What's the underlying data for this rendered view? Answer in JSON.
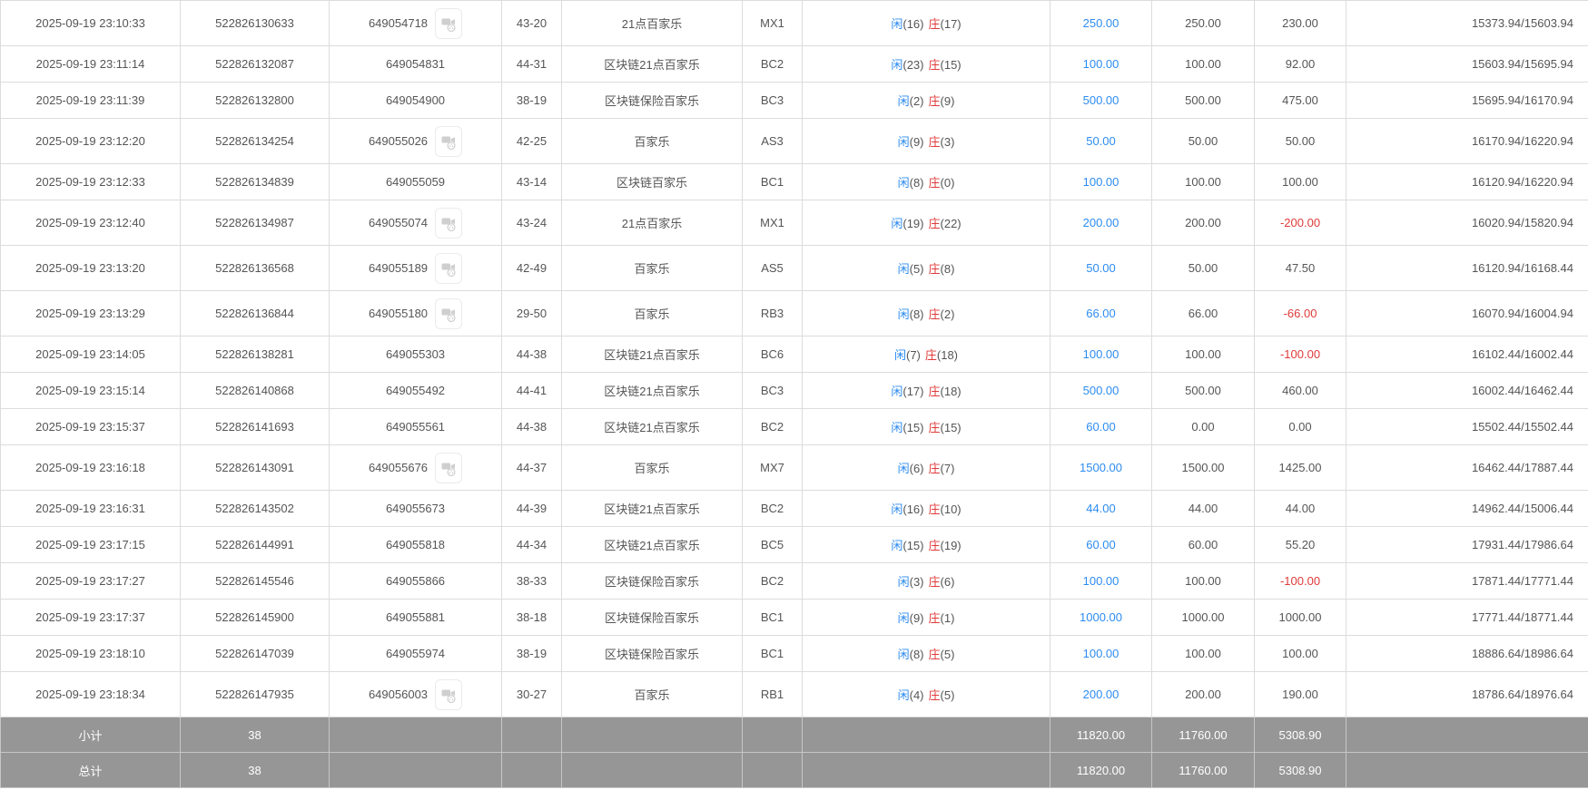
{
  "colors": {
    "link_blue": "#2d8cf0",
    "banker_red": "#e03a3a",
    "footer_bg": "#969696",
    "row_border": "#dcdcdc",
    "text": "#555555"
  },
  "icons": {
    "video": "video-replay-icon"
  },
  "rows": [
    {
      "time": "2025-09-19 23:10:33",
      "order": "522826130633",
      "round": "649054718",
      "video": true,
      "score": "43-20",
      "game": "21点百家乐",
      "table": "MX1",
      "xian": "闲",
      "xianCount": "(16)",
      "zhuang": "庄",
      "zhuangCount": "(17)",
      "bet": "250.00",
      "valid": "250.00",
      "winloss": "230.00",
      "balance": "15373.94/15603.94"
    },
    {
      "time": "2025-09-19 23:11:14",
      "order": "522826132087",
      "round": "649054831",
      "video": false,
      "score": "44-31",
      "game": "区块链21点百家乐",
      "table": "BC2",
      "xian": "闲",
      "xianCount": "(23)",
      "zhuang": "庄",
      "zhuangCount": "(15)",
      "bet": "100.00",
      "valid": "100.00",
      "winloss": "92.00",
      "balance": "15603.94/15695.94"
    },
    {
      "time": "2025-09-19 23:11:39",
      "order": "522826132800",
      "round": "649054900",
      "video": false,
      "score": "38-19",
      "game": "区块链保险百家乐",
      "table": "BC3",
      "xian": "闲",
      "xianCount": "(2)",
      "zhuang": "庄",
      "zhuangCount": "(9)",
      "bet": "500.00",
      "valid": "500.00",
      "winloss": "475.00",
      "balance": "15695.94/16170.94"
    },
    {
      "time": "2025-09-19 23:12:20",
      "order": "522826134254",
      "round": "649055026",
      "video": true,
      "score": "42-25",
      "game": "百家乐",
      "table": "AS3",
      "xian": "闲",
      "xianCount": "(9)",
      "zhuang": "庄",
      "zhuangCount": "(3)",
      "bet": "50.00",
      "valid": "50.00",
      "winloss": "50.00",
      "balance": "16170.94/16220.94"
    },
    {
      "time": "2025-09-19 23:12:33",
      "order": "522826134839",
      "round": "649055059",
      "video": false,
      "score": "43-14",
      "game": "区块链百家乐",
      "table": "BC1",
      "xian": "闲",
      "xianCount": "(8)",
      "zhuang": "庄",
      "zhuangCount": "(0)",
      "bet": "100.00",
      "valid": "100.00",
      "winloss": "100.00",
      "balance": "16120.94/16220.94"
    },
    {
      "time": "2025-09-19 23:12:40",
      "order": "522826134987",
      "round": "649055074",
      "video": true,
      "score": "43-24",
      "game": "21点百家乐",
      "table": "MX1",
      "xian": "闲",
      "xianCount": "(19)",
      "zhuang": "庄",
      "zhuangCount": "(22)",
      "bet": "200.00",
      "valid": "200.00",
      "winloss": "-200.00",
      "balance": "16020.94/15820.94"
    },
    {
      "time": "2025-09-19 23:13:20",
      "order": "522826136568",
      "round": "649055189",
      "video": true,
      "score": "42-49",
      "game": "百家乐",
      "table": "AS5",
      "xian": "闲",
      "xianCount": "(5)",
      "zhuang": "庄",
      "zhuangCount": "(8)",
      "bet": "50.00",
      "valid": "50.00",
      "winloss": "47.50",
      "balance": "16120.94/16168.44"
    },
    {
      "time": "2025-09-19 23:13:29",
      "order": "522826136844",
      "round": "649055180",
      "video": true,
      "score": "29-50",
      "game": "百家乐",
      "table": "RB3",
      "xian": "闲",
      "xianCount": "(8)",
      "zhuang": "庄",
      "zhuangCount": "(2)",
      "bet": "66.00",
      "valid": "66.00",
      "winloss": "-66.00",
      "balance": "16070.94/16004.94"
    },
    {
      "time": "2025-09-19 23:14:05",
      "order": "522826138281",
      "round": "649055303",
      "video": false,
      "score": "44-38",
      "game": "区块链21点百家乐",
      "table": "BC6",
      "xian": "闲",
      "xianCount": "(7)",
      "zhuang": "庄",
      "zhuangCount": "(18)",
      "bet": "100.00",
      "valid": "100.00",
      "winloss": "-100.00",
      "balance": "16102.44/16002.44"
    },
    {
      "time": "2025-09-19 23:15:14",
      "order": "522826140868",
      "round": "649055492",
      "video": false,
      "score": "44-41",
      "game": "区块链21点百家乐",
      "table": "BC3",
      "xian": "闲",
      "xianCount": "(17)",
      "zhuang": "庄",
      "zhuangCount": "(18)",
      "bet": "500.00",
      "valid": "500.00",
      "winloss": "460.00",
      "balance": "16002.44/16462.44"
    },
    {
      "time": "2025-09-19 23:15:37",
      "order": "522826141693",
      "round": "649055561",
      "video": false,
      "score": "44-38",
      "game": "区块链21点百家乐",
      "table": "BC2",
      "xian": "闲",
      "xianCount": "(15)",
      "zhuang": "庄",
      "zhuangCount": "(15)",
      "bet": "60.00",
      "valid": "0.00",
      "winloss": "0.00",
      "balance": "15502.44/15502.44"
    },
    {
      "time": "2025-09-19 23:16:18",
      "order": "522826143091",
      "round": "649055676",
      "video": true,
      "score": "44-37",
      "game": "百家乐",
      "table": "MX7",
      "xian": "闲",
      "xianCount": "(6)",
      "zhuang": "庄",
      "zhuangCount": "(7)",
      "bet": "1500.00",
      "valid": "1500.00",
      "winloss": "1425.00",
      "balance": "16462.44/17887.44"
    },
    {
      "time": "2025-09-19 23:16:31",
      "order": "522826143502",
      "round": "649055673",
      "video": false,
      "score": "44-39",
      "game": "区块链21点百家乐",
      "table": "BC2",
      "xian": "闲",
      "xianCount": "(16)",
      "zhuang": "庄",
      "zhuangCount": "(10)",
      "bet": "44.00",
      "valid": "44.00",
      "winloss": "44.00",
      "balance": "14962.44/15006.44"
    },
    {
      "time": "2025-09-19 23:17:15",
      "order": "522826144991",
      "round": "649055818",
      "video": false,
      "score": "44-34",
      "game": "区块链21点百家乐",
      "table": "BC5",
      "xian": "闲",
      "xianCount": "(15)",
      "zhuang": "庄",
      "zhuangCount": "(19)",
      "bet": "60.00",
      "valid": "60.00",
      "winloss": "55.20",
      "balance": "17931.44/17986.64"
    },
    {
      "time": "2025-09-19 23:17:27",
      "order": "522826145546",
      "round": "649055866",
      "video": false,
      "score": "38-33",
      "game": "区块链保险百家乐",
      "table": "BC2",
      "xian": "闲",
      "xianCount": "(3)",
      "zhuang": "庄",
      "zhuangCount": "(6)",
      "bet": "100.00",
      "valid": "100.00",
      "winloss": "-100.00",
      "balance": "17871.44/17771.44"
    },
    {
      "time": "2025-09-19 23:17:37",
      "order": "522826145900",
      "round": "649055881",
      "video": false,
      "score": "38-18",
      "game": "区块链保险百家乐",
      "table": "BC1",
      "xian": "闲",
      "xianCount": "(9)",
      "zhuang": "庄",
      "zhuangCount": "(1)",
      "bet": "1000.00",
      "valid": "1000.00",
      "winloss": "1000.00",
      "balance": "17771.44/18771.44"
    },
    {
      "time": "2025-09-19 23:18:10",
      "order": "522826147039",
      "round": "649055974",
      "video": false,
      "score": "38-19",
      "game": "区块链保险百家乐",
      "table": "BC1",
      "xian": "闲",
      "xianCount": "(8)",
      "zhuang": "庄",
      "zhuangCount": "(5)",
      "bet": "100.00",
      "valid": "100.00",
      "winloss": "100.00",
      "balance": "18886.64/18986.64"
    },
    {
      "time": "2025-09-19 23:18:34",
      "order": "522826147935",
      "round": "649056003",
      "video": true,
      "score": "30-27",
      "game": "百家乐",
      "table": "RB1",
      "xian": "闲",
      "xianCount": "(4)",
      "zhuang": "庄",
      "zhuangCount": "(5)",
      "bet": "200.00",
      "valid": "200.00",
      "winloss": "190.00",
      "balance": "18786.64/18976.64"
    }
  ],
  "footer": [
    {
      "label": "小计",
      "count": "38",
      "bet": "11820.00",
      "valid": "11760.00",
      "winloss": "5308.90"
    },
    {
      "label": "总计",
      "count": "38",
      "bet": "11820.00",
      "valid": "11760.00",
      "winloss": "5308.90"
    }
  ]
}
